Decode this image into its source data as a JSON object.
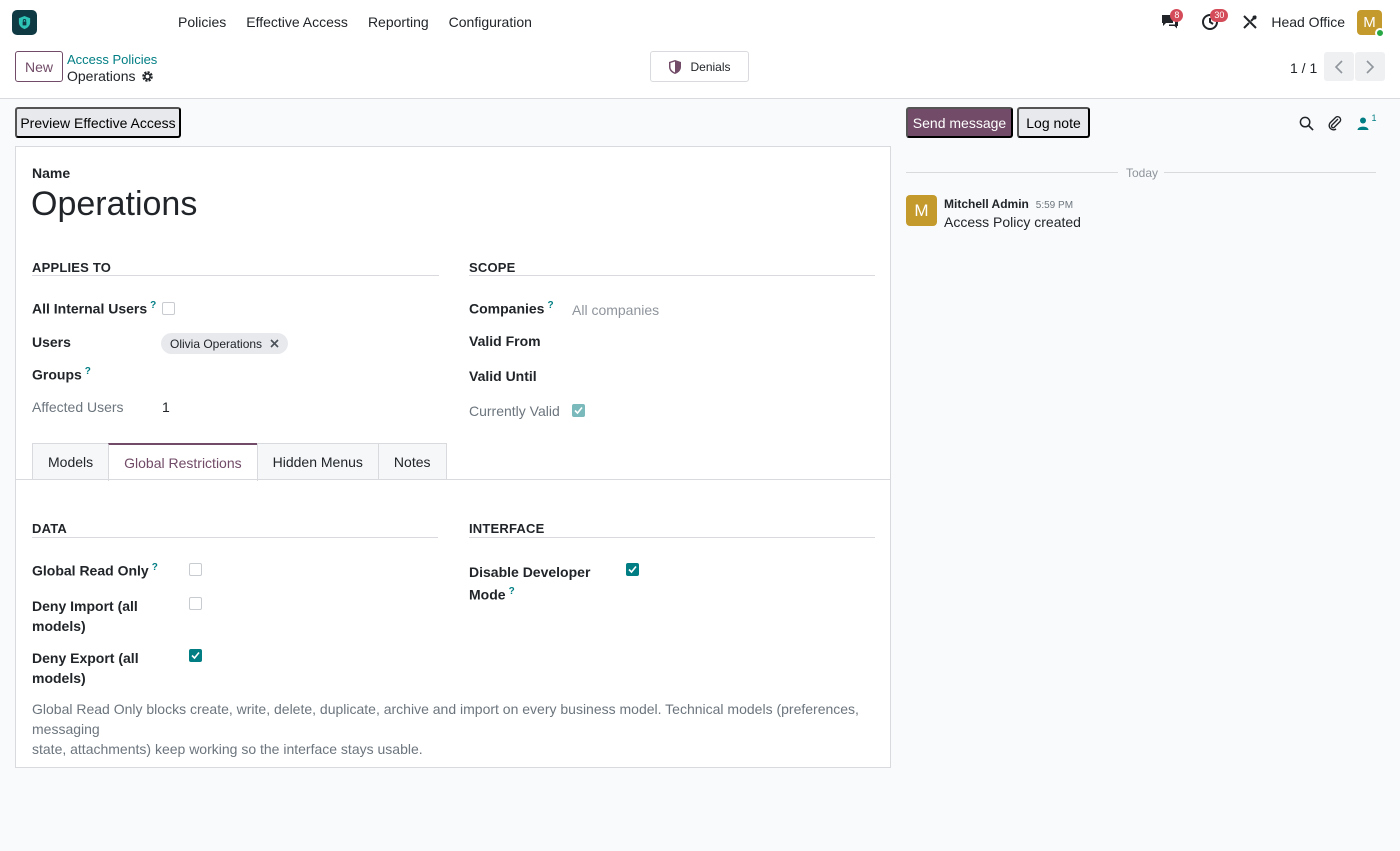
{
  "nav": {
    "menu": [
      "Policies",
      "Effective Access",
      "Reporting",
      "Configuration"
    ],
    "messages_count": "8",
    "activities_count": "30",
    "company": "Head Office",
    "user_initial": "M"
  },
  "control": {
    "new_label": "New",
    "breadcrumb_parent": "Access Policies",
    "breadcrumb_current": "Operations",
    "denials_label": "Denials",
    "pager": "1 / 1"
  },
  "form": {
    "preview_label": "Preview Effective Access",
    "name_label": "Name",
    "name_value": "Operations",
    "applies_to": {
      "title": "APPLIES TO",
      "all_internal_users": "All Internal Users",
      "users_label": "Users",
      "user_tag": "Olivia Operations",
      "groups_label": "Groups",
      "affected_users_label": "Affected Users",
      "affected_users_value": "1"
    },
    "scope": {
      "title": "SCOPE",
      "companies_label": "Companies",
      "companies_placeholder": "All companies",
      "valid_from_label": "Valid From",
      "valid_until_label": "Valid Until",
      "currently_valid_label": "Currently Valid"
    },
    "tabs": [
      "Models",
      "Global Restrictions",
      "Hidden Menus",
      "Notes"
    ],
    "data_section": {
      "title": "DATA",
      "global_read_only": "Global Read Only",
      "deny_import_l1": "Deny Import (all",
      "deny_import_l2": "models)",
      "deny_export_l1": "Deny Export (all",
      "deny_export_l2": "models)"
    },
    "interface_section": {
      "title": "INTERFACE",
      "disable_dev_l1": "Disable Developer",
      "disable_dev_l2": "Mode"
    },
    "note_l1": "Global Read Only blocks create, write, delete, duplicate, archive and import on every business model. Technical models (preferences, messaging",
    "note_l2": "state, attachments) keep working so the interface stays usable."
  },
  "chatter": {
    "send_label": "Send message",
    "log_label": "Log note",
    "followers_count": "1",
    "today_label": "Today",
    "author": "Mitchell Admin",
    "time": "5:59 PM",
    "body": "Access Policy created",
    "author_initial": "M"
  },
  "colors": {
    "brand": "#714b67",
    "accent": "#017e84"
  }
}
